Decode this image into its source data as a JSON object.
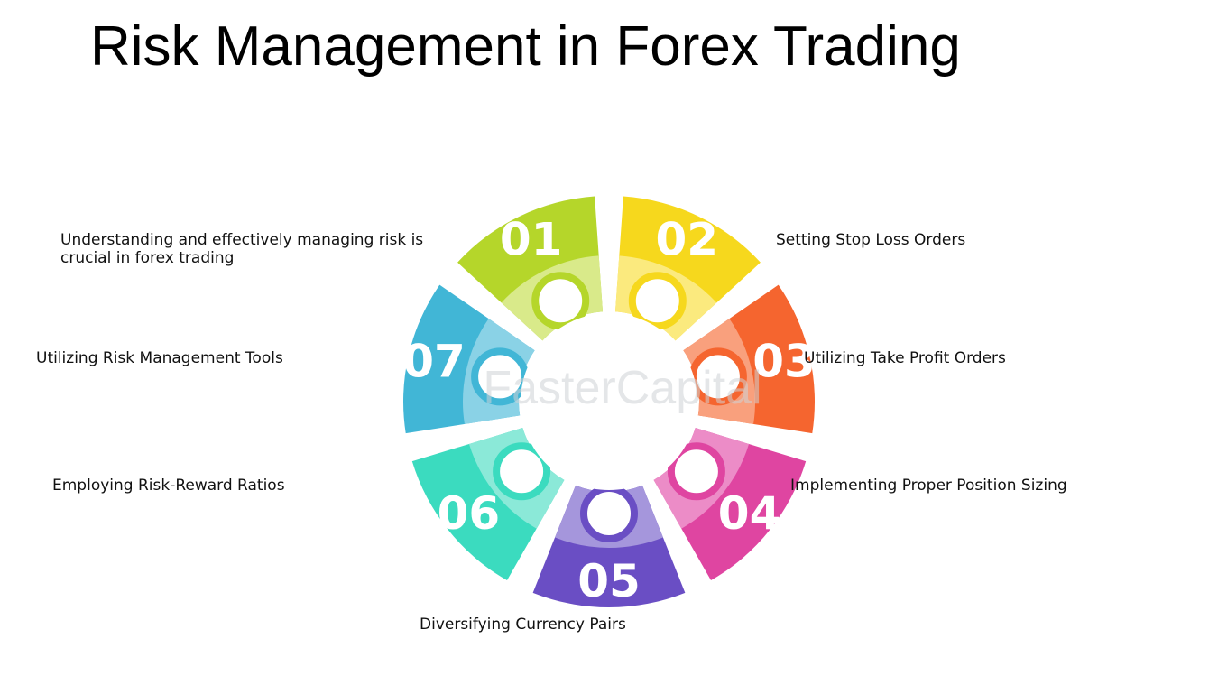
{
  "title": "Risk Management in Forex Trading",
  "watermark": "FasterCapital",
  "steps": [
    {
      "number": "01",
      "label_lines": [
        "Understanding and effectively managing risk is",
        "crucial in forex trading"
      ],
      "color": "#b5d62a",
      "light": "#d9ea8a"
    },
    {
      "number": "02",
      "label_lines": [
        "Setting Stop Loss Orders"
      ],
      "color": "#f6d81d",
      "light": "#fbea7e"
    },
    {
      "number": "03",
      "label_lines": [
        "Utilizing Take Profit Orders"
      ],
      "color": "#f5652f",
      "light": "#f9a07d"
    },
    {
      "number": "04",
      "label_lines": [
        "Implementing Proper Position Sizing"
      ],
      "color": "#df45a1",
      "light": "#ec8cc7"
    },
    {
      "number": "05",
      "label_lines": [
        "Diversifying Currency Pairs"
      ],
      "color": "#6a4ec4",
      "light": "#a596dc"
    },
    {
      "number": "06",
      "label_lines": [
        "Employing Risk-Reward Ratios"
      ],
      "color": "#3bdbbf",
      "light": "#8be9d8"
    },
    {
      "number": "07",
      "label_lines": [
        "Utilizing Risk Management Tools"
      ],
      "color": "#41b6d6",
      "light": "#8ad2e6"
    }
  ]
}
